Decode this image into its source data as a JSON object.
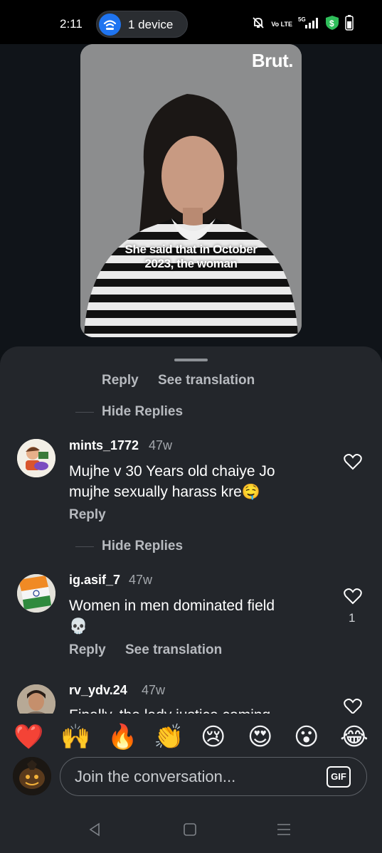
{
  "status_bar": {
    "time": "2:11",
    "device_pill_label": "1 device",
    "network_label": "Vo LTE",
    "signal_label": "5G"
  },
  "video": {
    "brand": "Brut.",
    "caption_line1": "She said that in October",
    "caption_line2": "2023, the woman"
  },
  "comments": {
    "top_actions": {
      "reply": "Reply",
      "see_translation": "See translation"
    },
    "hide_replies_1": "Hide Replies",
    "items": [
      {
        "username": "mints_1772",
        "time": "47w",
        "text_line1": "Mujhe v 30 Years old chaiye Jo",
        "text_line2": "mujhe sexually harass kre🤤",
        "reply": "Reply",
        "likes": ""
      },
      {
        "username": "ig.asif_7",
        "time": "47w",
        "text_line1": "Women in men dominated field",
        "text_line2": "💀",
        "reply": "Reply",
        "see_translation": "See translation",
        "likes": "1"
      },
      {
        "username": "rv_ydv.24",
        "time": "47w",
        "text_line1": "Finally, the lady justice coming",
        "reply": "",
        "likes": ""
      }
    ],
    "hide_replies_2": "Hide Replies"
  },
  "reactions": [
    "❤️",
    "🙌",
    "🔥",
    "👏",
    "😢",
    "😍",
    "😮",
    "😂"
  ],
  "composer": {
    "placeholder": "Join the conversation...",
    "gif_label": "GIF"
  },
  "colors": {
    "sheet_bg": "#23262b",
    "accent_blue": "#1f74f0",
    "shield_green": "#2fbe5a"
  }
}
